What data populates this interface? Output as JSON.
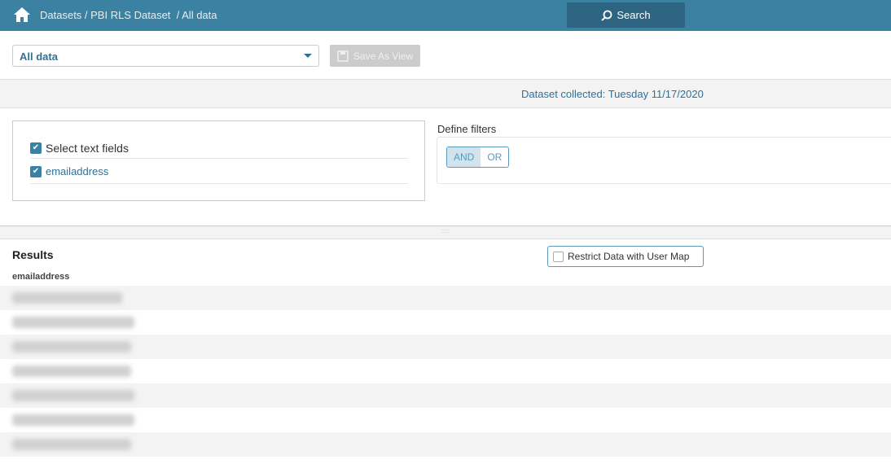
{
  "header": {
    "breadcrumb": "Datasets / PBI RLS Dataset  / All data",
    "search_label": "Search"
  },
  "toolbar": {
    "view_selected": "All data",
    "save_label": "Save As View"
  },
  "dataset_collected": "Dataset collected: Tuesday 11/17/2020",
  "fields": {
    "select_all_label": "Select text fields",
    "items": [
      "emailaddress"
    ]
  },
  "filters": {
    "title": "Define filters",
    "and_label": "AND",
    "or_label": "OR",
    "active": "AND"
  },
  "results": {
    "title": "Results",
    "restrict_label": "Restrict Data with User Map",
    "column": "emailaddress",
    "row_count_visible": 7
  },
  "colors": {
    "header": "#3a81a2",
    "accent": "#2f7196"
  }
}
